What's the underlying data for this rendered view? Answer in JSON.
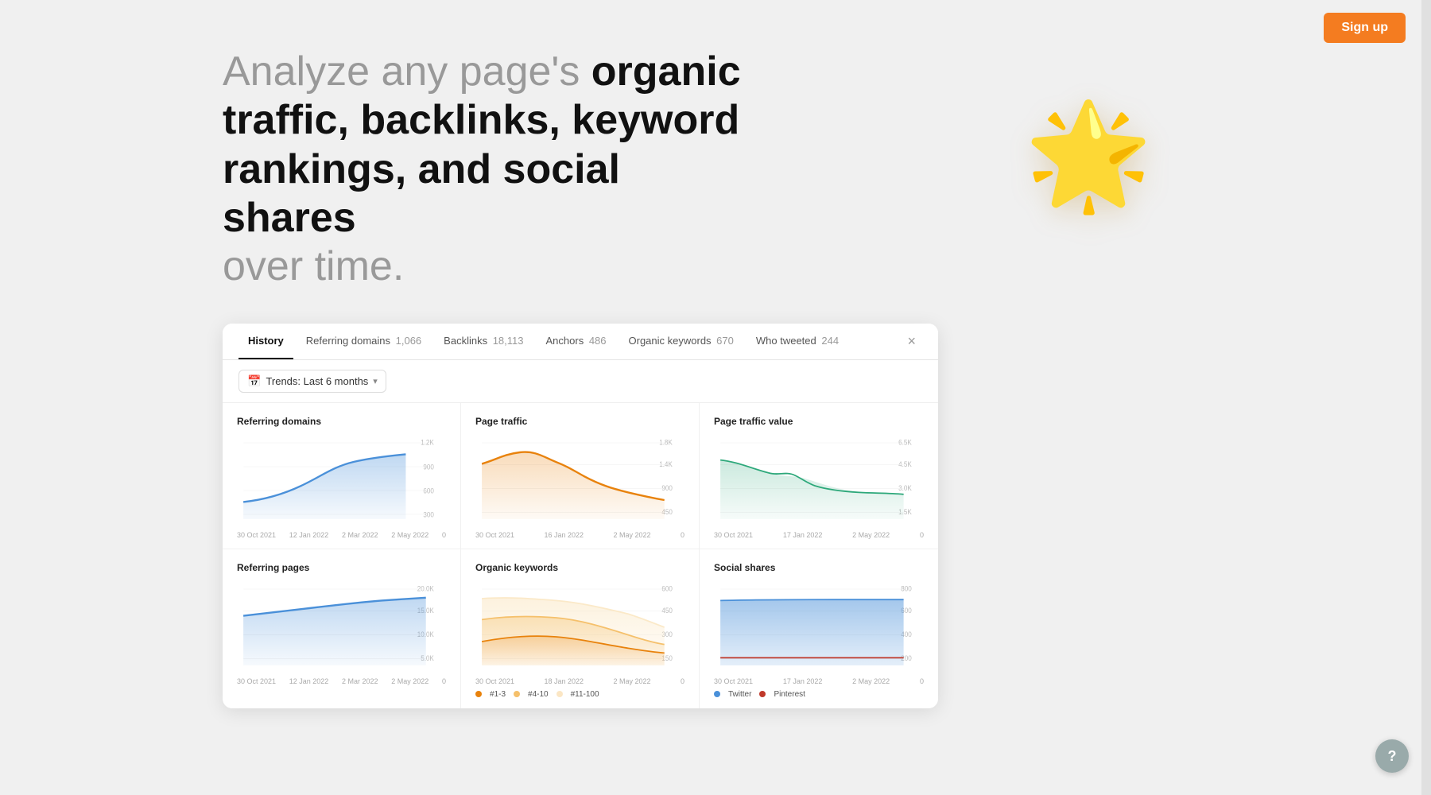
{
  "nav": {
    "signup_label": "Sign up"
  },
  "hero": {
    "line1": "Analyze any page's ",
    "line1_bold": "organic",
    "line2_bold": "traffic, backlinks, keyword",
    "line3_bold": "rankings, and social shares",
    "line4": "over time."
  },
  "star": "⭐",
  "dashboard": {
    "tabs": [
      {
        "id": "history",
        "label": "History",
        "count": null,
        "active": true
      },
      {
        "id": "referring_domains",
        "label": "Referring domains",
        "count": "1,066",
        "active": false
      },
      {
        "id": "backlinks",
        "label": "Backlinks",
        "count": "18,113",
        "active": false
      },
      {
        "id": "anchors",
        "label": "Anchors",
        "count": "486",
        "active": false
      },
      {
        "id": "organic_keywords",
        "label": "Organic keywords",
        "count": "670",
        "active": false
      },
      {
        "id": "who_tweeted",
        "label": "Who tweeted",
        "count": "244",
        "active": false
      }
    ],
    "close_label": "×",
    "filter": {
      "icon": "📅",
      "label": "Trends: Last 6 months",
      "arrow": "▾"
    },
    "charts": [
      {
        "id": "referring-domains",
        "title": "Referring domains",
        "x_labels": [
          "30 Oct 2021",
          "12 Jan 2022",
          "2 Mar 2022",
          "2 May 2022",
          "0"
        ],
        "y_labels": [
          "1.2K",
          "900",
          "600",
          "300"
        ],
        "color": "#4a90d9",
        "fill": "rgba(74,144,217,0.18)",
        "type": "area"
      },
      {
        "id": "page-traffic",
        "title": "Page traffic",
        "x_labels": [
          "30 Oct 2021",
          "16 Jan 2022",
          "2 May 2022",
          "0"
        ],
        "y_labels": [
          "1.8K",
          "1.4K",
          "900",
          "450"
        ],
        "color": "#e8820c",
        "fill": "rgba(232,130,12,0.12)",
        "type": "area"
      },
      {
        "id": "page-traffic-value",
        "title": "Page traffic value",
        "x_labels": [
          "30 Oct 2021",
          "17 Jan 2022",
          "2 May 2022",
          "0"
        ],
        "y_labels": [
          "6.5K",
          "4.5K",
          "3.0K",
          "1.5K"
        ],
        "color": "#2da87a",
        "fill": "rgba(45,168,122,0.12)",
        "type": "area"
      },
      {
        "id": "referring-pages",
        "title": "Referring pages",
        "x_labels": [
          "30 Oct 2021",
          "12 Jan 2022",
          "2 Mar 2022",
          "2 May 2022",
          "0"
        ],
        "y_labels": [
          "20.0K",
          "15.0K",
          "10.0K",
          "5.0K"
        ],
        "color": "#4a90d9",
        "fill": "rgba(74,144,217,0.18)",
        "type": "area"
      },
      {
        "id": "organic-keywords",
        "title": "Organic keywords",
        "x_labels": [
          "30 Oct 2021",
          "18 Jan 2022",
          "2 May 2022",
          "0"
        ],
        "y_labels": [
          "600",
          "450",
          "300",
          "150"
        ],
        "color": "#e8820c",
        "fill": "rgba(232,130,12,0.12)",
        "type": "area_multi",
        "legend": [
          {
            "label": "#1-3",
            "color": "#e8820c"
          },
          {
            "label": "#4-10",
            "color": "#f5c06b"
          },
          {
            "label": "#11-100",
            "color": "#fbe9c8"
          }
        ]
      },
      {
        "id": "social-shares",
        "title": "Social shares",
        "x_labels": [
          "30 Oct 2021",
          "17 Jan 2022",
          "2 May 2022",
          "0"
        ],
        "y_labels": [
          "800",
          "600",
          "400",
          "200"
        ],
        "color": "#4a90d9",
        "fill": "rgba(74,144,217,0.35)",
        "type": "area_multi",
        "legend": [
          {
            "label": "Twitter",
            "color": "#4a90d9"
          },
          {
            "label": "Pinterest",
            "color": "#c0392b"
          }
        ]
      }
    ]
  },
  "help_label": "?"
}
